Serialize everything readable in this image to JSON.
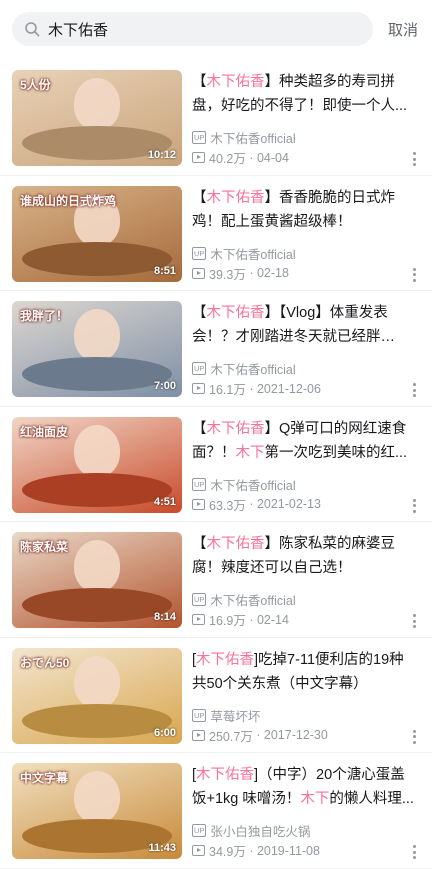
{
  "search": {
    "query": "木下佑香",
    "cancel_label": "取消"
  },
  "results": [
    {
      "title_parts": [
        [
          "【",
          0
        ],
        [
          "木下佑香",
          1
        ],
        [
          "】种类超多的寿司拼盘，好吃的不得了！即使一个人...",
          0
        ]
      ],
      "uploader": "木下佑香official",
      "views": "40.2万",
      "date": "04-04",
      "duration": "10:12",
      "thumb_colors": [
        "#c9a37a",
        "#e8d2b8"
      ],
      "thumb_text": "5人份"
    },
    {
      "title_parts": [
        [
          "【",
          0
        ],
        [
          "木下佑香",
          1
        ],
        [
          "】香香脆脆的日式炸鸡！配上蛋黄酱超级棒！",
          0
        ]
      ],
      "uploader": "木下佑香official",
      "views": "39.3万",
      "date": "02-18",
      "duration": "8:51",
      "thumb_colors": [
        "#a66a3a",
        "#d8b38a"
      ],
      "thumb_text": "谁成山的日式炸鸡"
    },
    {
      "title_parts": [
        [
          "【",
          0
        ],
        [
          "木下佑香",
          1
        ],
        [
          "】【Vlog】体重发表会！？才刚踏进冬天就已经胖了！？",
          0
        ]
      ],
      "uploader": "木下佑香official",
      "views": "16.1万",
      "date": "2021-12-06",
      "duration": "7:00",
      "thumb_colors": [
        "#7f8fa6",
        "#dcd6cf"
      ],
      "thumb_text": "我胖了！"
    },
    {
      "title_parts": [
        [
          "【",
          0
        ],
        [
          "木下佑香",
          1
        ],
        [
          "】Q弹可口的网红速食面？！",
          0
        ],
        [
          "木下",
          1
        ],
        [
          "第一次吃到美味的红...",
          0
        ]
      ],
      "uploader": "木下佑香official",
      "views": "63.3万",
      "date": "2021-02-13",
      "duration": "4:51",
      "thumb_colors": [
        "#c94a2a",
        "#f0d6c6"
      ],
      "thumb_text": "红油面皮"
    },
    {
      "title_parts": [
        [
          "【",
          0
        ],
        [
          "木下佑香",
          1
        ],
        [
          "】陈家私菜的麻婆豆腐！辣度还可以自己选！",
          0
        ]
      ],
      "uploader": "木下佑香official",
      "views": "16.9万",
      "date": "02-14",
      "duration": "8:14",
      "thumb_colors": [
        "#b3542e",
        "#e9d8c8"
      ],
      "thumb_text": "陈家私菜"
    },
    {
      "title_parts": [
        [
          "[",
          0
        ],
        [
          "木下佑香",
          1
        ],
        [
          "]吃掉7-11便利店的19种共50个关东煮（中文字幕）",
          0
        ]
      ],
      "uploader": "草莓坏坏",
      "views": "250.7万",
      "date": "2017-12-30",
      "duration": "6:00",
      "thumb_colors": [
        "#d9a64e",
        "#f2e6d0"
      ],
      "thumb_text": "おでん50"
    },
    {
      "title_parts": [
        [
          "[",
          0
        ],
        [
          "木下佑香",
          1
        ],
        [
          "]（中字）20个溏心蛋盖饭+1kg 味噌汤！",
          0
        ],
        [
          "木下",
          1
        ],
        [
          "的懒人料理...",
          0
        ]
      ],
      "uploader": "张小白独自吃火锅",
      "views": "34.9万",
      "date": "2019-11-08",
      "duration": "11:43",
      "thumb_colors": [
        "#c98a3a",
        "#f0e0c0"
      ],
      "thumb_text": "中文字幕"
    }
  ]
}
